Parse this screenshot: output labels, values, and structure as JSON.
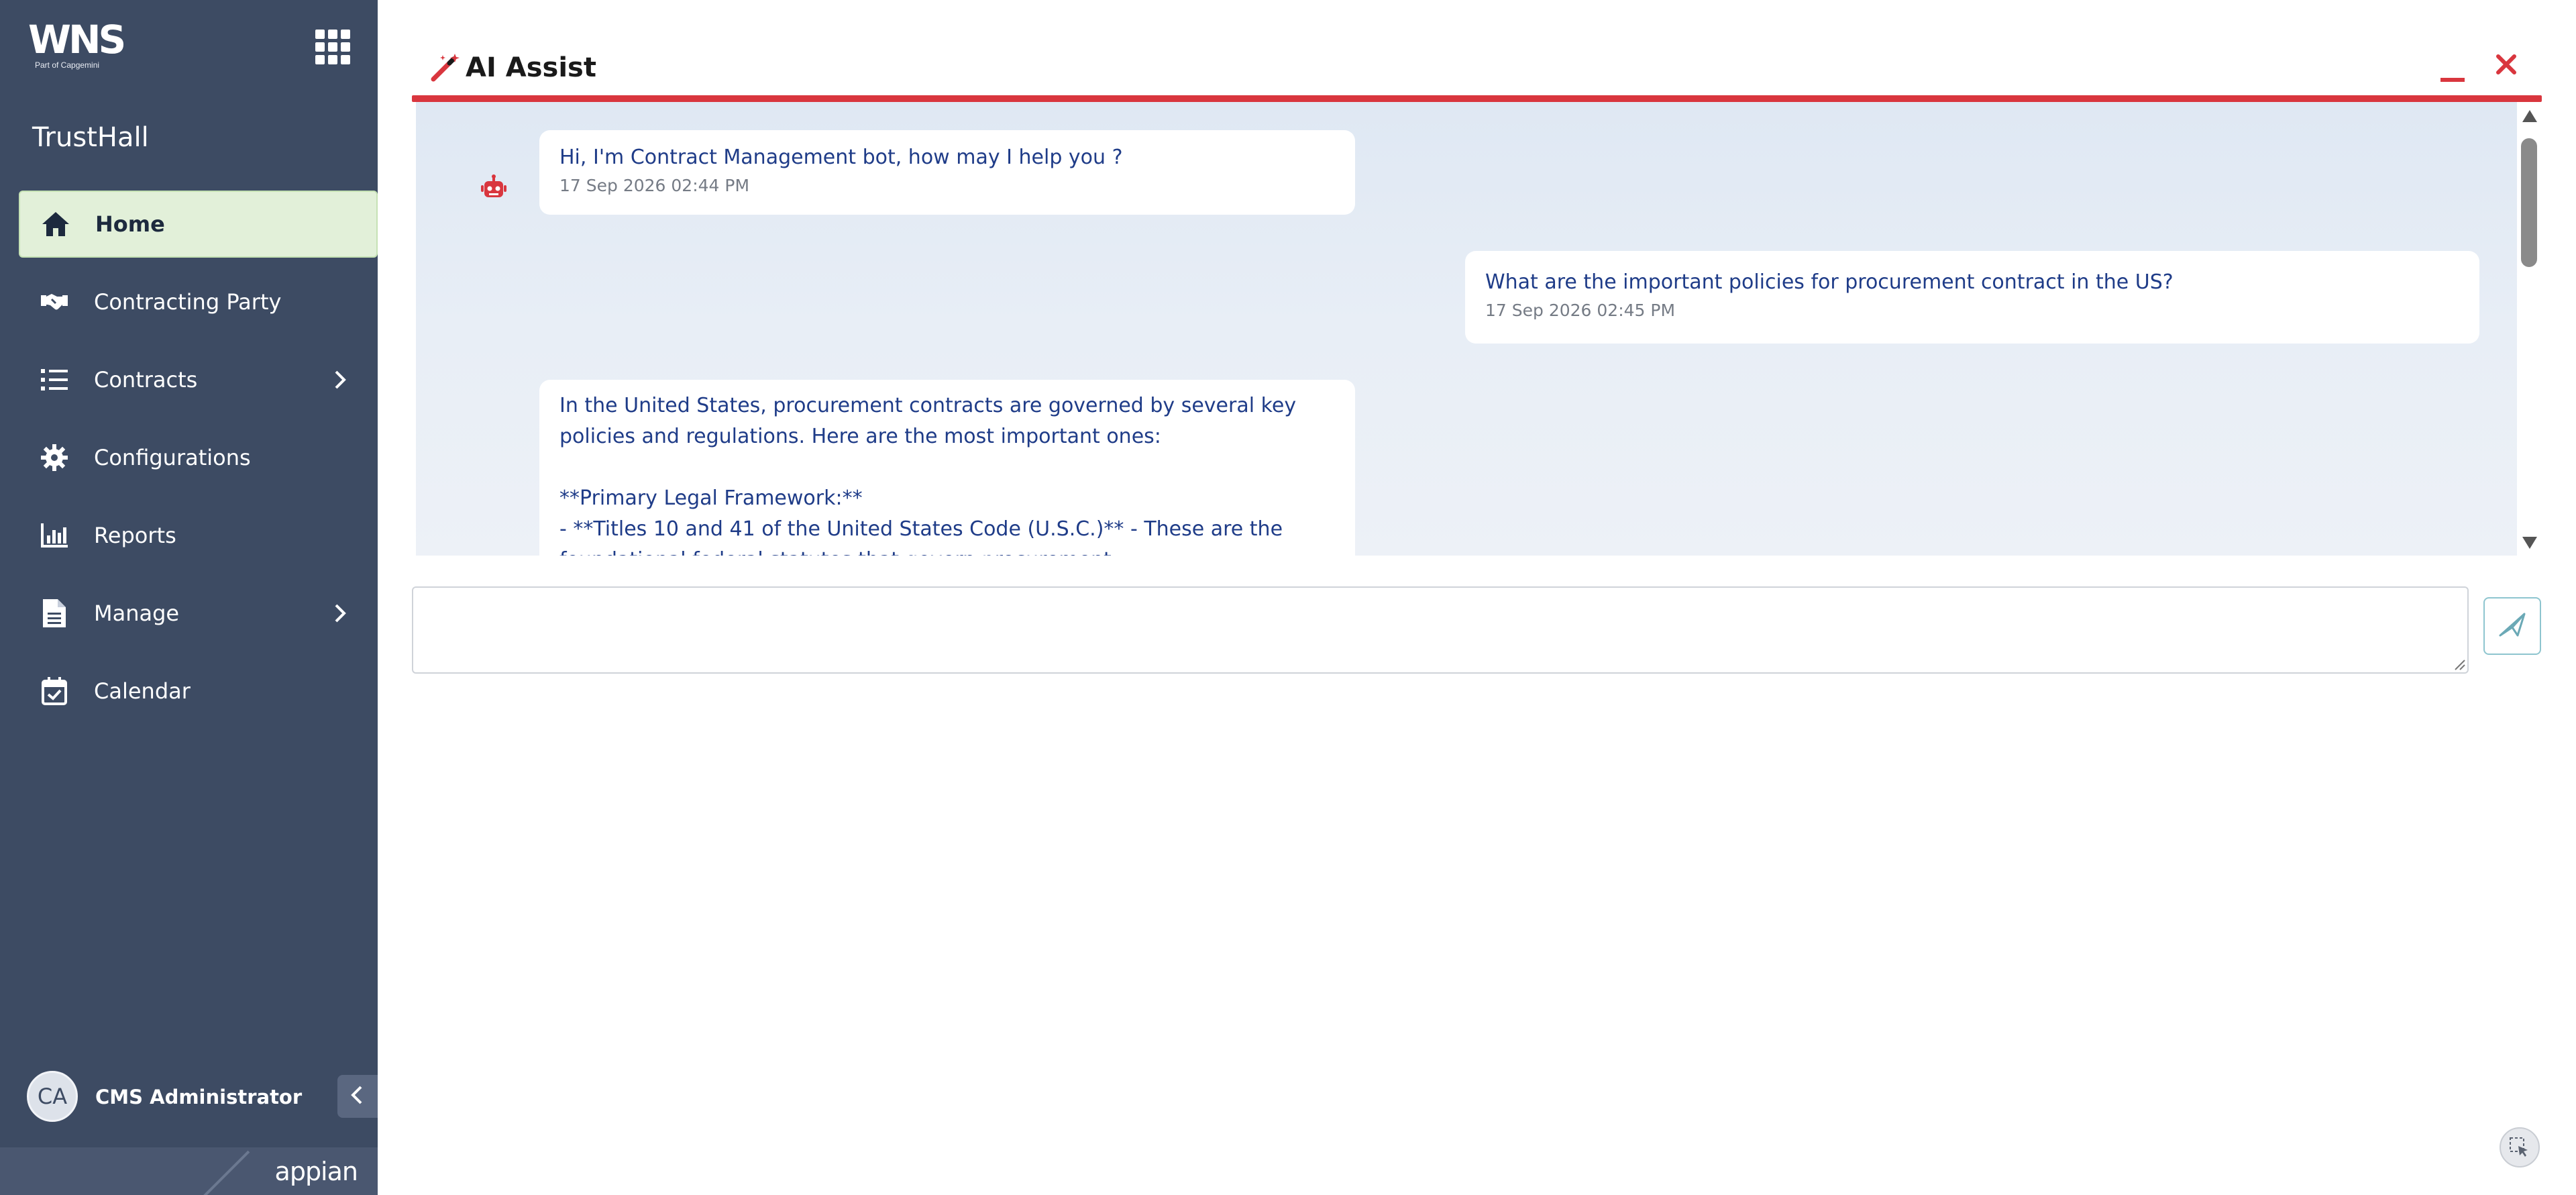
{
  "brand": {
    "name": "WNS",
    "tagline": "Part of Capgemini"
  },
  "sidebar": {
    "site_name": "TrustHall",
    "items": [
      {
        "label": "Home",
        "icon": "home-icon",
        "active": true
      },
      {
        "label": "Contracting Party",
        "icon": "handshake-icon"
      },
      {
        "label": "Contracts",
        "icon": "list-icon",
        "has_submenu": true
      },
      {
        "label": "Configurations",
        "icon": "gear-icon"
      },
      {
        "label": "Reports",
        "icon": "bar-chart-icon"
      },
      {
        "label": "Manage",
        "icon": "document-icon",
        "has_submenu": true
      },
      {
        "label": "Calendar",
        "icon": "calendar-check-icon"
      }
    ],
    "user": {
      "initials": "CA",
      "name": "CMS Administrator"
    },
    "footer_logo": "appian"
  },
  "panel": {
    "title": "AI Assist",
    "accent_color": "#d9363e"
  },
  "chat": {
    "messages": [
      {
        "sender": "bot",
        "text": "Hi, I'm Contract Management bot, how may I help you ?",
        "timestamp": "17 Sep 2026 02:44 PM"
      },
      {
        "sender": "user",
        "text": "What are the important policies for procurement contract in the US?",
        "timestamp": "17 Sep 2026 02:45 PM"
      },
      {
        "sender": "bot",
        "text": "In the United States, procurement contracts are governed by several key policies and regulations. Here are the most important ones:\n\n**Primary Legal Framework:**\n- **Titles 10 and 41 of the United States Code (U.S.C.)** - These are the foundational federal statutes that govern procurement"
      }
    ]
  },
  "composer": {
    "placeholder": ""
  }
}
